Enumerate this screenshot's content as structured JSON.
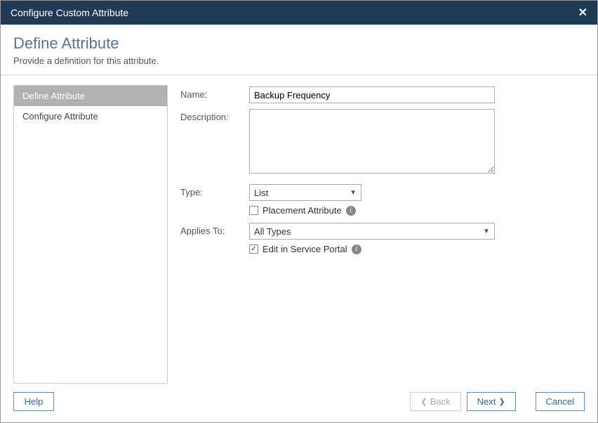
{
  "title": "Configure Custom Attribute",
  "header": {
    "heading": "Define Attribute",
    "subheading": "Provide a definition for this attribute."
  },
  "sidebar": {
    "steps": [
      {
        "label": "Define Attribute",
        "active": true
      },
      {
        "label": "Configure Attribute",
        "active": false
      }
    ]
  },
  "form": {
    "name": {
      "label": "Name:",
      "value": "Backup Frequency"
    },
    "description": {
      "label": "Description:",
      "value": ""
    },
    "type": {
      "label": "Type:",
      "value": "List"
    },
    "placement": {
      "label": "Placement Attribute",
      "checked": false
    },
    "appliesTo": {
      "label": "Applies To:",
      "value": "All Types"
    },
    "editInPortal": {
      "label": "Edit in Service Portal",
      "checked": true
    }
  },
  "footer": {
    "help": "Help",
    "back": "Back",
    "next": "Next",
    "cancel": "Cancel"
  }
}
